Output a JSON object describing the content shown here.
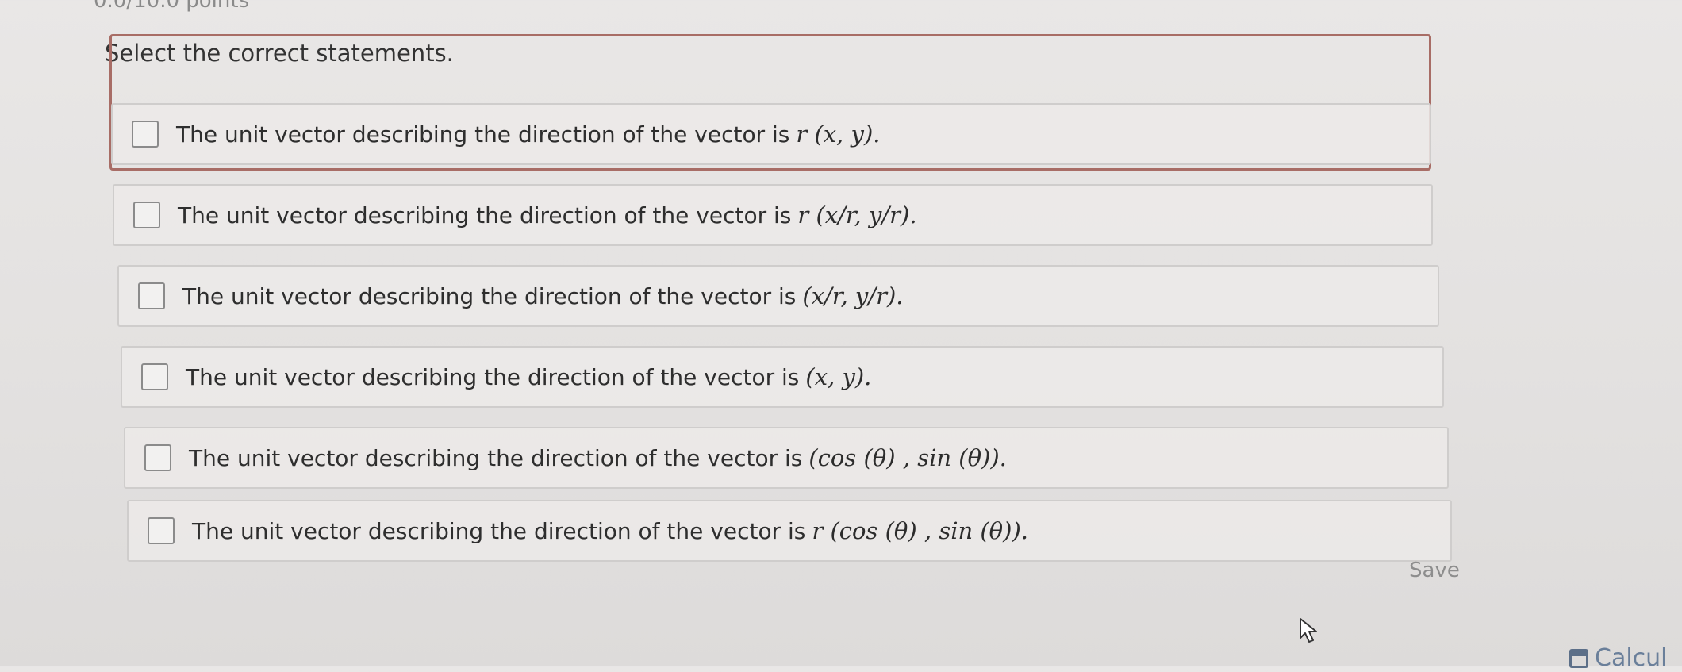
{
  "header": {
    "points_partial": "0.0/10.0 points"
  },
  "question": {
    "prompt": "Select the correct statements."
  },
  "options": [
    {
      "prefix": "The unit vector describing the direction of the vector is",
      "math": "r (x, y).",
      "checked": false
    },
    {
      "prefix": "The unit vector describing the direction of the vector is",
      "math": "r (x/r, y/r).",
      "checked": false
    },
    {
      "prefix": "The unit vector describing the direction of the vector is",
      "math": "(x/r, y/r).",
      "checked": false
    },
    {
      "prefix": "The unit vector describing the direction of the vector is",
      "math": "(x, y).",
      "checked": false
    },
    {
      "prefix": "The unit vector describing the direction of the vector is",
      "math": "(cos (θ) , sin (θ)).",
      "checked": false
    },
    {
      "prefix": "The unit vector describing the direction of the vector is",
      "math": "r (cos (θ) , sin (θ)).",
      "checked": false
    }
  ],
  "actions": {
    "save_label": "Save",
    "calculator_label": "Calcul"
  },
  "colors": {
    "highlight_border": "#a86d66",
    "option_border": "#cfcdcc",
    "background": "#e6e4e3"
  }
}
